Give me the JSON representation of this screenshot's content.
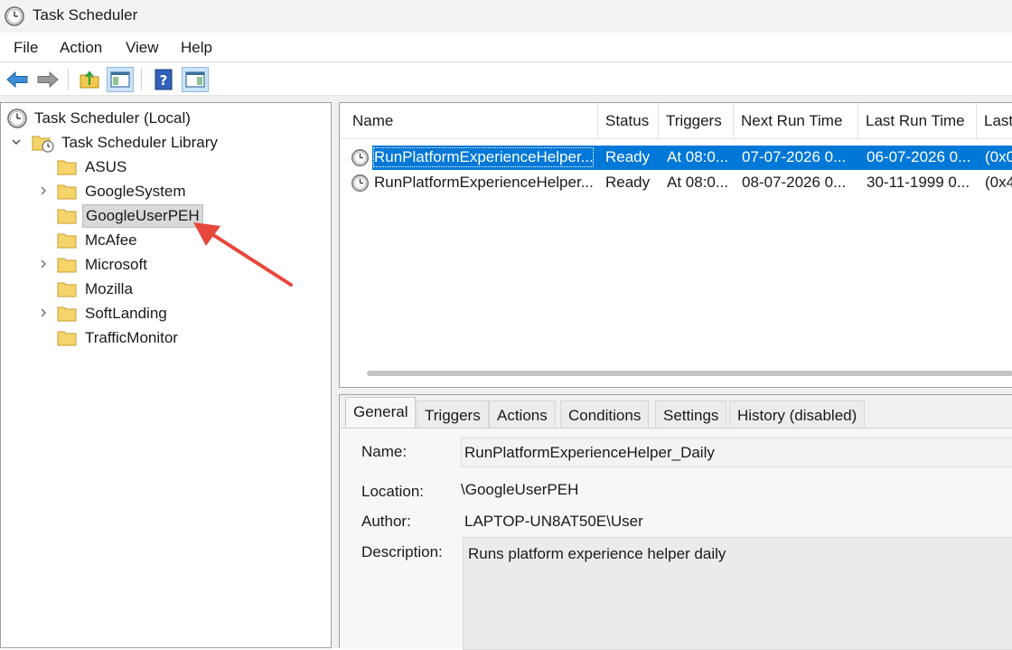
{
  "window": {
    "title": "Task Scheduler"
  },
  "menu": [
    "File",
    "Action",
    "View",
    "Help"
  ],
  "tree": {
    "root": "Task Scheduler (Local)",
    "library": "Task Scheduler Library",
    "folders": [
      {
        "label": "ASUS",
        "expandable": false,
        "selected": false
      },
      {
        "label": "GoogleSystem",
        "expandable": true,
        "selected": false
      },
      {
        "label": "GoogleUserPEH",
        "expandable": false,
        "selected": true
      },
      {
        "label": "McAfee",
        "expandable": false,
        "selected": false
      },
      {
        "label": "Microsoft",
        "expandable": true,
        "selected": false
      },
      {
        "label": "Mozilla",
        "expandable": false,
        "selected": false
      },
      {
        "label": "SoftLanding",
        "expandable": true,
        "selected": false
      },
      {
        "label": "TrafficMonitor",
        "expandable": false,
        "selected": false
      }
    ]
  },
  "task_list": {
    "columns": [
      "Name",
      "Status",
      "Triggers",
      "Next Run Time",
      "Last Run Time",
      "Last"
    ],
    "rows": [
      {
        "name": "RunPlatformExperienceHelper...",
        "status": "Ready",
        "triggers": "At 08:0...",
        "next_run": "07-07-2026 0...",
        "last_run": "06-07-2026 0...",
        "last_result": "(0x0",
        "selected": true
      },
      {
        "name": "RunPlatformExperienceHelper...",
        "status": "Ready",
        "triggers": "At 08:0...",
        "next_run": "08-07-2026 0...",
        "last_run": "30-11-1999 0...",
        "last_result": "(0x4",
        "selected": false
      }
    ]
  },
  "details": {
    "tabs": [
      "General",
      "Triggers",
      "Actions",
      "Conditions",
      "Settings",
      "History (disabled)"
    ],
    "active_tab": "General",
    "labels": {
      "name": "Name:",
      "location": "Location:",
      "author": "Author:",
      "description": "Description:"
    },
    "values": {
      "name": "RunPlatformExperienceHelper_Daily",
      "location": "\\GoogleUserPEH",
      "author": "LAPTOP-UN8AT50E\\User",
      "description": "Runs platform experience helper daily"
    }
  },
  "colors": {
    "selection": "#0078d7",
    "arrow": "#e8473b",
    "folder": "#f5d56b"
  }
}
